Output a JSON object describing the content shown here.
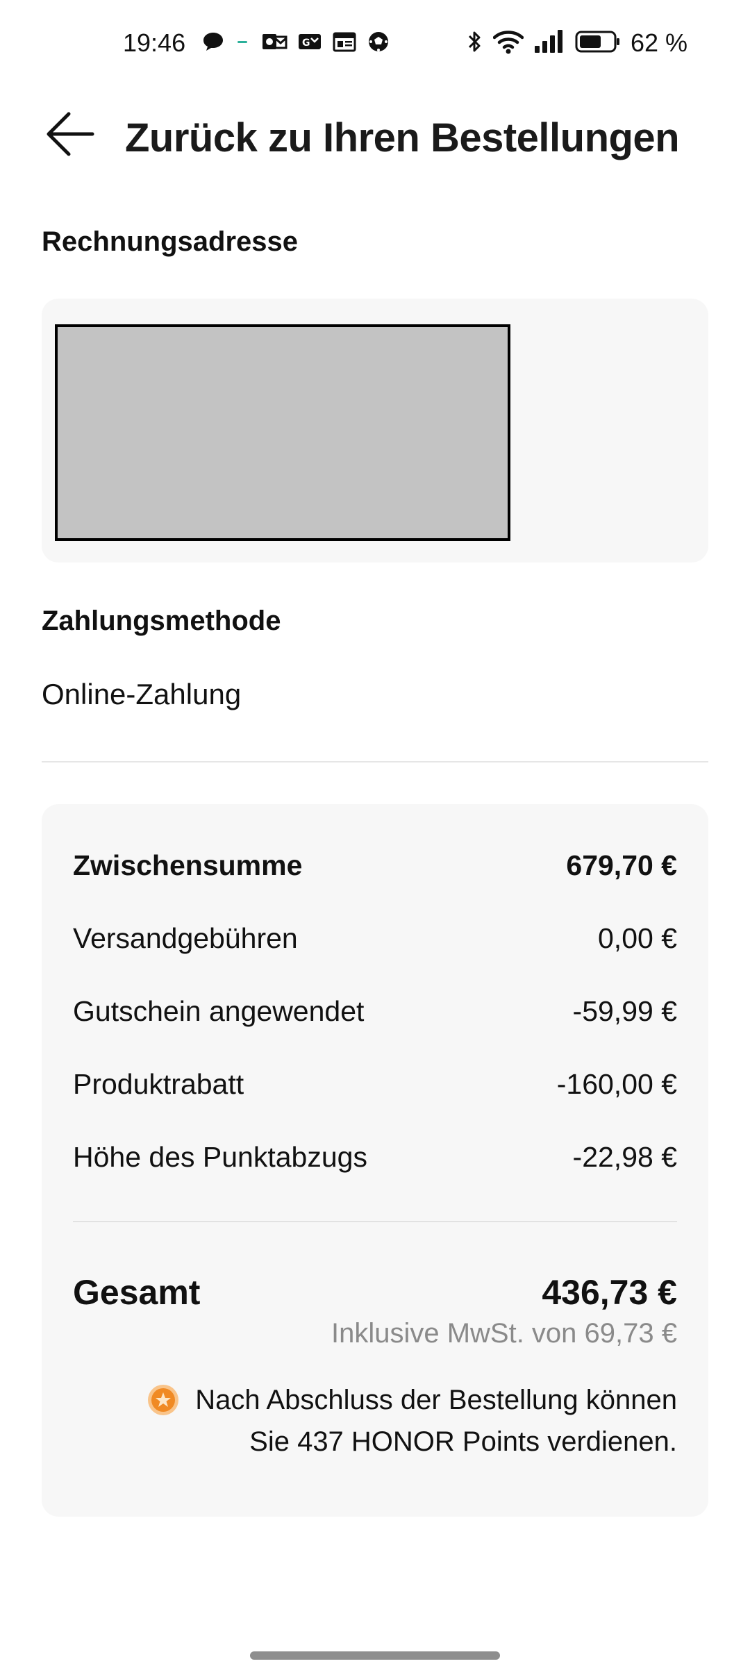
{
  "status_bar": {
    "time": "19:46",
    "battery_text": "62 %",
    "left_icons": [
      "chat-bubble-icon",
      "dash-indicator-icon",
      "outlook-icon",
      "gmail-icon",
      "news-icon",
      "soccer-ball-icon"
    ],
    "right_icons": [
      "bluetooth-icon",
      "wifi-icon",
      "signal-icon",
      "battery-icon"
    ]
  },
  "header": {
    "back_icon": "back-arrow-icon",
    "title": "Zurück zu Ihren Bestellungen"
  },
  "billing": {
    "label": "Rechnungsadresse"
  },
  "payment": {
    "label": "Zahlungsmethode",
    "method": "Online-Zahlung"
  },
  "summary": {
    "rows": [
      {
        "label": "Zwischensumme",
        "value": "679,70 €"
      },
      {
        "label": "Versandgebühren",
        "value": "0,00 €"
      },
      {
        "label": "Gutschein angewendet",
        "value": "-59,99 €"
      },
      {
        "label": "Produktrabatt",
        "value": "-160,00 €"
      },
      {
        "label": "Höhe des Punktabzugs",
        "value": "-22,98 €"
      }
    ],
    "total_label": "Gesamt",
    "total_value": "436,73 €",
    "vat_text": "Inklusive MwSt. von 69,73 €",
    "points_icon": "honor-points-coin-icon",
    "points_line1": "Nach Abschluss der Bestellung können",
    "points_line2": "Sie 437 HONOR Points verdienen."
  },
  "colors": {
    "card_background": "#f7f7f7",
    "muted_text": "#8a8a8a",
    "coin_orange": "#f08a24"
  }
}
